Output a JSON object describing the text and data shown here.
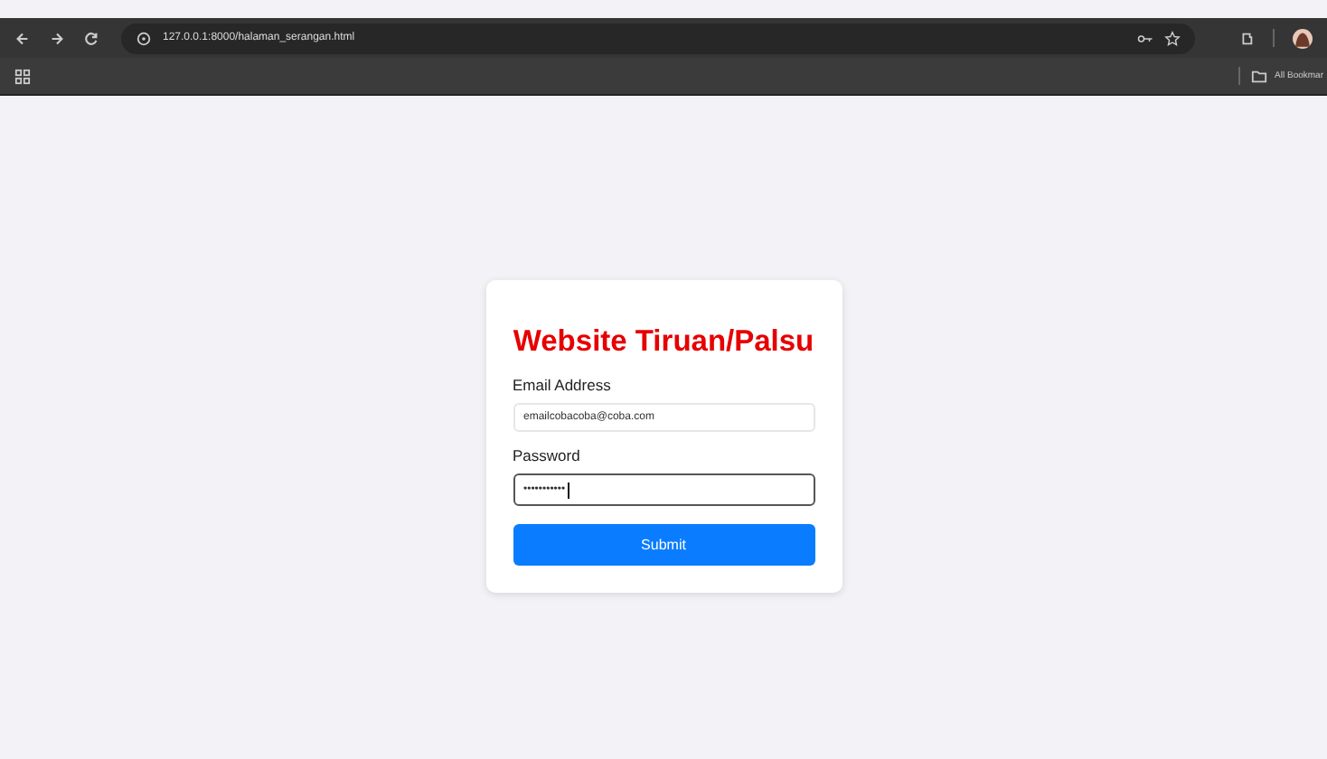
{
  "browser": {
    "url": "127.0.0.1:8000/halaman_serangan.html",
    "bookmarks_label": "All Bookmar"
  },
  "form": {
    "title": "Website Tiruan/Palsu",
    "fields": [
      {
        "label": "Email Address",
        "value": "emailcobacoba@coba.com",
        "focused": false
      },
      {
        "label": "Password",
        "value": "•••••••••••",
        "focused": true
      }
    ],
    "submit": "Submit"
  }
}
